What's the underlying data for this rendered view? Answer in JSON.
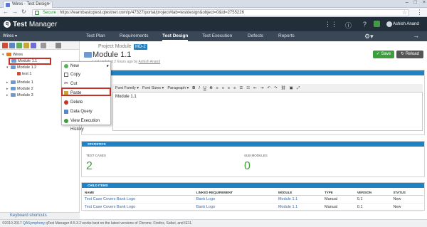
{
  "browser": {
    "tab_title": "Wires - Test Design",
    "url_secure": "Secure",
    "url": "https://learnbasicqtest.qtestnet.com/p/47327/portal/project#tab=testdesign&object=0&id=2755226"
  },
  "app": {
    "logo_q": "q",
    "logo_test": "Test",
    "logo_manager": "Manager",
    "user_name": "Ashish Anand",
    "project": "Wires",
    "nav": [
      "Test Plan",
      "Requirements",
      "Test Design",
      "Test Execution",
      "Defects",
      "Reports"
    ],
    "active_nav": "Test Design"
  },
  "tree": {
    "root": "Wires",
    "items": [
      "Module 1.1",
      "Module 1.2",
      "test 1",
      "Module 1",
      "Module 2",
      "Module 3"
    ]
  },
  "context_menu": {
    "items": [
      "New",
      "Copy",
      "Cut",
      "Paste",
      "Delete",
      "Data Query",
      "View Execution History"
    ]
  },
  "main": {
    "crumb": "Project Module",
    "badge": "MD-2",
    "title": "Module 1.1",
    "subtitle_prefix": "Last updated 2 hours ago by",
    "subtitle_user": "Ashish Anand",
    "save_label": "Save",
    "reload_label": "Reload",
    "description_header": "DESCRIPTION",
    "editor_toolbar": [
      "Font Family",
      "Font Sizes",
      "Paragraph",
      "B",
      "I",
      "U",
      "S"
    ],
    "editor_text": "Module 1.1",
    "statistics_header": "STATISTICS",
    "test_cases_label": "TEST CASES",
    "test_cases_value": "2",
    "sub_modules_label": "SUB MODULES",
    "sub_modules_value": "0",
    "child_header": "CHILD ITEMS",
    "table_headers": [
      "NAME",
      "LINKED REQUIREMENT",
      "MODULE",
      "TYPE",
      "VERSION",
      "STATUS"
    ],
    "rows": [
      [
        "Test Case Covers Bank Logo",
        "Bank Logo",
        "Module 1.1",
        "Manual",
        "0.1",
        "New"
      ],
      [
        "Test Case Covers Bank Logo",
        "Bank Logo",
        "Module 1.1",
        "Manual",
        "0.1",
        "New"
      ]
    ]
  },
  "footer": {
    "keyboard_shortcuts": "Keyboard shortcuts",
    "copyright": "©2010-2017",
    "company": "QASymphony",
    "notice": "qTest Manager 8.5.3.2 works best on the latest versions of Chrome, Firefox, Safari, and IE11."
  },
  "colors": {
    "header_dark": "#232e3b",
    "nav_bar": "#3a4757",
    "section_blue": "#1e82c4",
    "save_green": "#3c9f3c",
    "highlight_red": "#c3322a"
  }
}
